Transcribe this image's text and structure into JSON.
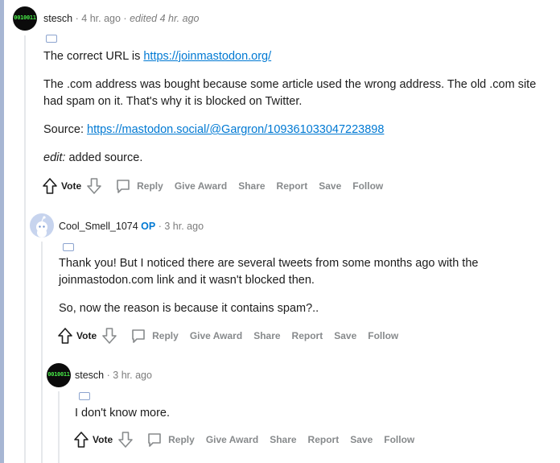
{
  "comments": [
    {
      "author": "stesch",
      "age": "4 hr. ago",
      "edited": "edited 4 hr. ago",
      "paragraphs": {
        "p1_prefix": "The correct URL is ",
        "p1_link": "https://joinmastodon.org/",
        "p2": "The .com address was bought because some article used the wrong address. The old .com site had spam on it. That's why it is blocked on Twitter.",
        "p3_prefix": "Source: ",
        "p3_link": "https://mastodon.social/@Gargron/109361033047223898",
        "p4_em": "edit:",
        "p4_rest": " added source."
      }
    },
    {
      "author": "Cool_Smell_1074",
      "op": "OP",
      "age": "3 hr. ago",
      "paragraphs": {
        "p1": "Thank you! But I noticed there are several tweets from some months ago with the joinmastodon.com link and it wasn't blocked then.",
        "p2": "So, now the reason is because it contains spam?.."
      }
    },
    {
      "author": "stesch",
      "age": "3 hr. ago",
      "paragraphs": {
        "p1": "I don't know more."
      }
    }
  ],
  "actions": {
    "vote": "Vote",
    "reply": "Reply",
    "give_award": "Give Award",
    "share": "Share",
    "report": "Report",
    "save": "Save",
    "follow": "Follow"
  },
  "meta_separator": "·",
  "avatar_text": "0010011",
  "colors": {
    "thread_bar": "#a7b6d3",
    "link": "#0079d3",
    "muted": "#878a8c",
    "op": "#0079d3",
    "avatar_bg": "#0b0b0b",
    "avatar_text": "#46e646"
  }
}
